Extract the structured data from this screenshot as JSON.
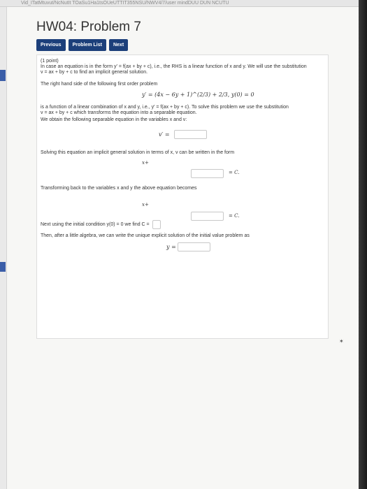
{
  "browser": {
    "url_fragment": "Vid_ITatMtuvut/NcNutIt TOaSu1Ha1tsOUeUTTIT355NSU/NWV4/7/user mindDUU DUN NCUTU"
  },
  "page": {
    "title": "HW04: Problem 7"
  },
  "nav": {
    "previous": "Previous",
    "problem_list": "Problem List",
    "next": "Next"
  },
  "problem": {
    "points": "(1 point)",
    "intro1": "In case an equation is in the form y′ = f(ax + by + c), i.e., the RHS is a linear function of x and y. We will use the substitution",
    "intro2": "v = ax + by + c to find an implicit general solution.",
    "rhs_text": "The right hand side of the following first order problem",
    "equation": "y′ = (4x − 6y + 1)^(2/3) + 2/3,  y(0) = 0",
    "linear1": "is a function of a linear combination of x and y, i.e., y′ = f(ax + by + c). To solve this problem we use the substitution",
    "linear2": "v = ax + by + c which transforms the equation into a separable equation.",
    "separable_text": "We obtain the following separable equation in the variables x and v:",
    "vprime": "v′ =",
    "solving_text": "Solving this equation an implicit general solution in terms of x, v can be written in the form",
    "xplus1": "x+",
    "eqC1": "= C.",
    "transform_text": "Transforming back to the variables x and y the above equation becomes",
    "xplus2": "x+",
    "eqC2": "= C.",
    "next_text": "Next using the initial condition y(0) = 0 we find C =",
    "then_text": "Then, after a little algebra, we can write the unique explicit solution of the initial value problem as",
    "yeq": "y ="
  }
}
